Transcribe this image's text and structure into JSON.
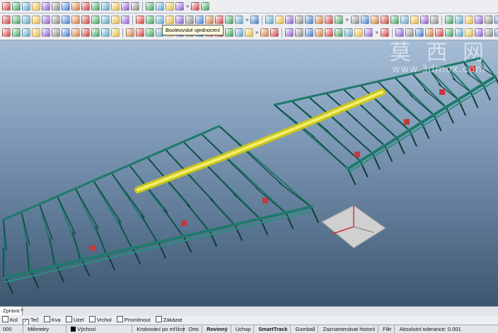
{
  "tooltip": {
    "text": "Booleovské sjednocení"
  },
  "watermark": {
    "cn": "莫 西 网",
    "url": "www.3dmox.com"
  },
  "viewport": {
    "tab_label": "Zprava",
    "tab_add": "+"
  },
  "osnap": [
    {
      "label": "Kol",
      "checked": false
    },
    {
      "label": "Teč",
      "checked": true
    },
    {
      "label": "Kva",
      "checked": false
    },
    {
      "label": "Uzel",
      "checked": false
    },
    {
      "label": "Vrchol",
      "checked": false
    },
    {
      "label": "Promítnout",
      "checked": false
    },
    {
      "label": "Zakázat",
      "checked": false
    }
  ],
  "status": {
    "coord": "000",
    "units": "Milimetry",
    "layer": "Výchozí",
    "grid_snap": "Krokování po mřížce",
    "ortho": "Orto",
    "planar": "Rovinný",
    "osnap": "Uchop",
    "smarttrack": "SmartTrack",
    "gumball": "Gumball",
    "history": "Zaznamenávat historii",
    "filter": "Filtr",
    "tolerance": "Absolutní tolerance: 0.001"
  },
  "icons": {
    "colors": [
      "#d23a3a",
      "#e7b93a",
      "#3a7bd2",
      "#3aa25a",
      "#8a5ad2",
      "#d27a3a",
      "#55a3c9",
      "#888888"
    ]
  }
}
